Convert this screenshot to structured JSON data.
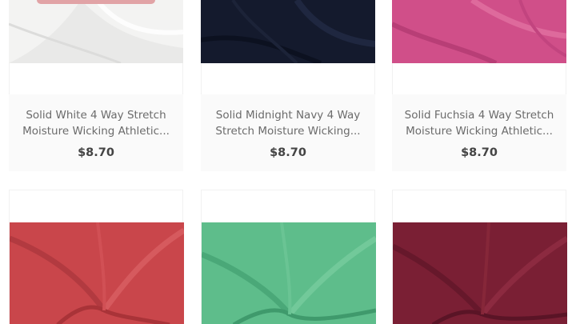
{
  "products_row1": [
    {
      "title_line1": "Solid White 4 Way Stretch",
      "title_line2": "Moisture Wicking Athletic...",
      "price": "$8.70",
      "color": "#f3f3f2"
    },
    {
      "title_line1": "Solid Midnight Navy 4 Way",
      "title_line2": "Stretch Moisture Wicking...",
      "price": "$8.70",
      "color": "#141a2d"
    },
    {
      "title_line1": "Solid Fuchsia 4 Way Stretch",
      "title_line2": "Moisture Wicking Athletic...",
      "price": "$8.70",
      "color": "#d04f89"
    }
  ],
  "products_row2": [
    {
      "color": "#c9464b"
    },
    {
      "color": "#5ebd8b"
    },
    {
      "color": "#7a1f34"
    }
  ]
}
